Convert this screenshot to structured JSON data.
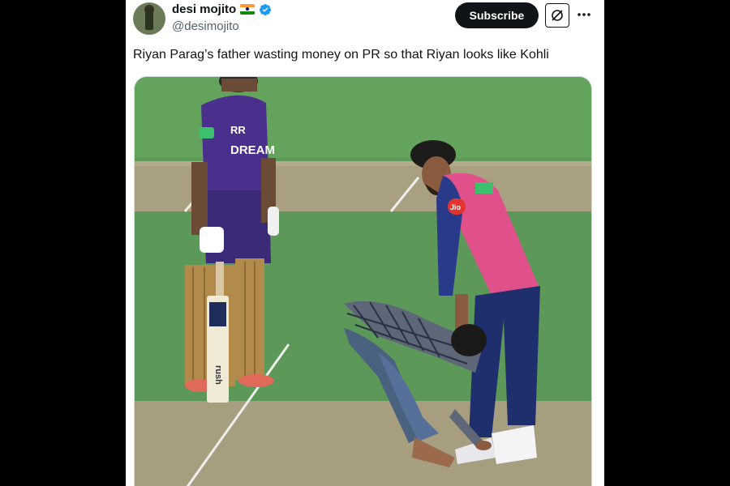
{
  "author": {
    "display_name": "desi mojito",
    "handle": "@desimojito",
    "flag_icon": "india-flag-icon",
    "verified_icon": "verified-badge-icon"
  },
  "actions": {
    "subscribe_label": "Subscribe",
    "grok_icon": "grok-icon",
    "more_icon": "more-options-icon"
  },
  "tweet": {
    "text": "Riyan Parag’s father wasting money on PR so that Riyan looks like Kohli"
  },
  "media": {
    "jersey_text_left": "DREAM",
    "jersey_logo_left": "RR",
    "bat_text": "rush",
    "badge_text": "Jio",
    "colors": {
      "pitch_green": "#5e9b5a",
      "pitch_strip": "#a89f80",
      "kkr_purple": "#4b2f8c",
      "rr_pink": "#e0518c",
      "rr_navy": "#1f2f6e"
    }
  }
}
